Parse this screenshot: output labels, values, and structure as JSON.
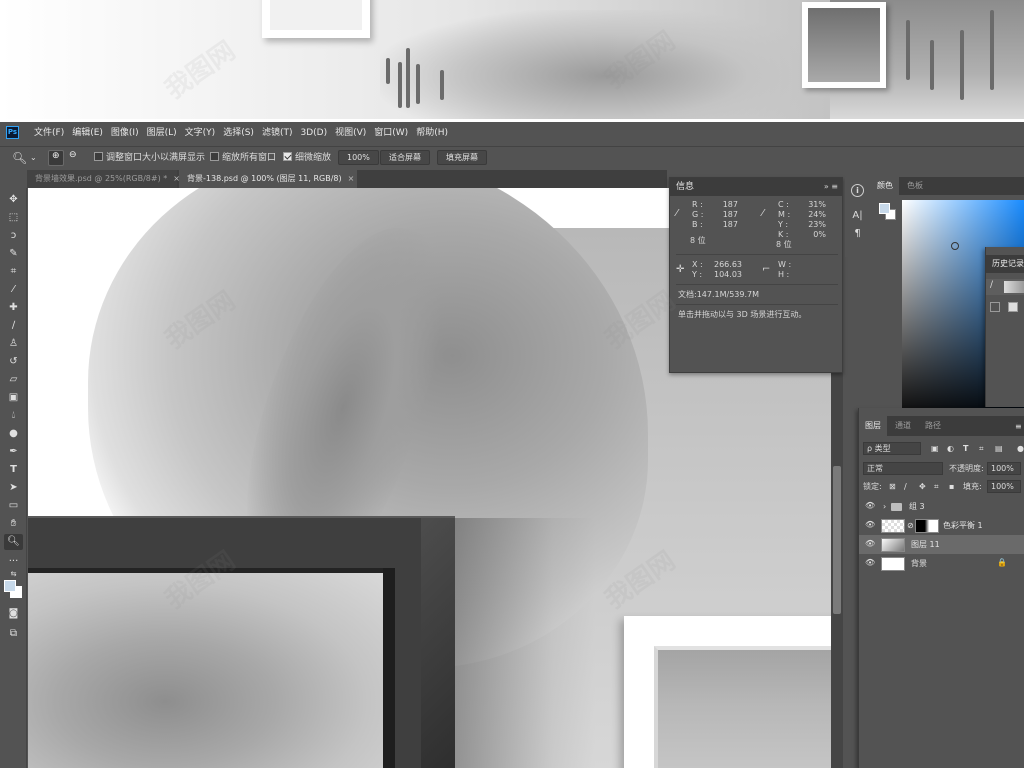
{
  "window": {
    "app_logo": "Ps"
  },
  "menu": [
    "文件(F)",
    "编辑(E)",
    "图像(I)",
    "图层(L)",
    "文字(Y)",
    "选择(S)",
    "滤镜(T)",
    "3D(D)",
    "视图(V)",
    "窗口(W)",
    "帮助(H)"
  ],
  "options": {
    "resize_windows": "调整窗口大小以满屏显示",
    "zoom_all_windows": "缩放所有窗口",
    "scrubby_zoom": "细微缩放",
    "zoom_value": "100%",
    "fit_screen": "适合屏幕",
    "fill_screen": "填充屏幕",
    "resize_windows_checked": false,
    "zoom_all_checked": false,
    "scrubby_checked": true
  },
  "tabs": [
    {
      "label": "背景墙效果.psd @ 25%(RGB/8#) *",
      "active": false
    },
    {
      "label": "背景-138.psd @ 100% (图层 11, RGB/8)",
      "active": true
    }
  ],
  "tab_close": "×",
  "info": {
    "title": "信息",
    "menu": "»  ≡",
    "r_label": "R :",
    "r": "187",
    "g_label": "G :",
    "g": "187",
    "b_label": "B :",
    "b": "187",
    "c_label": "C :",
    "c": "31%",
    "m_label": "M :",
    "m": "24%",
    "y_label": "Y :",
    "y": "23%",
    "k_label": "K :",
    "k": "0%",
    "bit_left": "8 位",
    "bit_right": "8 位",
    "x_label": "X :",
    "x": "266.63",
    "y2_label": "Y :",
    "y2": "104.03",
    "w_label": "W :",
    "h_label": "H :",
    "doc_size": "文档:147.1M/539.7M",
    "hint": "单击并拖动以与 3D 场景进行互动。"
  },
  "color_panel": {
    "tab_color": "颜色",
    "tab_swatches": "色板",
    "foreground": "#c7d9ea",
    "background": "#ffffff",
    "hue_color": "#1a8cff"
  },
  "history_panel": {
    "title": "历史记录"
  },
  "layers_panel": {
    "tab_layers": "图层",
    "tab_channels": "通道",
    "tab_paths": "路径",
    "filter_kind": "ρ 类型",
    "blend_mode": "正常",
    "opacity_label": "不透明度:",
    "opacity": "100%",
    "lock_label": "锁定:",
    "fill_label": "填充:",
    "fill": "100%",
    "layers": [
      {
        "name": "组 3",
        "kind": "group",
        "selected": false
      },
      {
        "name": "色彩平衡 1",
        "kind": "adjustment",
        "selected": false
      },
      {
        "name": "图层 11",
        "kind": "pixel",
        "selected": true
      },
      {
        "name": "背景",
        "kind": "background",
        "selected": false
      }
    ]
  },
  "watermark": "我图网",
  "icons": {
    "eye": "👁",
    "lock": "🔒"
  }
}
